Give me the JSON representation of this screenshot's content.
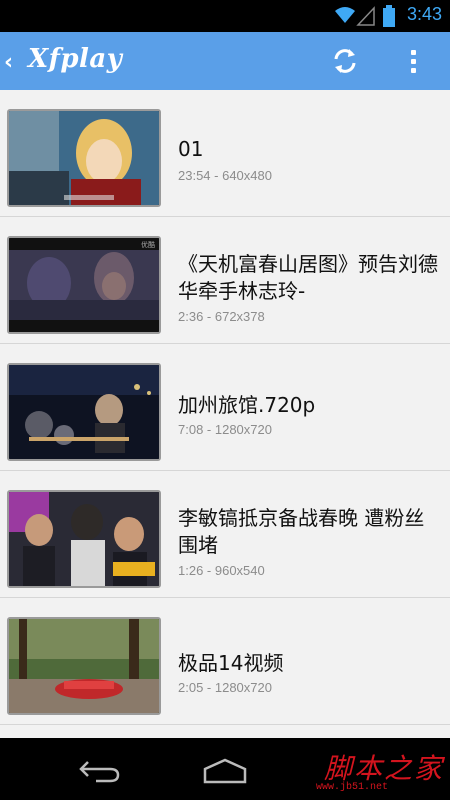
{
  "status_bar": {
    "time": "3:43",
    "icons": [
      "wifi-icon",
      "signal-icon",
      "battery-icon"
    ]
  },
  "action_bar": {
    "title": "Xfplay",
    "back_icon": "chevron-left-icon",
    "actions": [
      "refresh-icon",
      "overflow-menu-icon"
    ],
    "color": "#5a9fe8"
  },
  "videos": [
    {
      "title": "01",
      "meta": "23:54 - 640x480"
    },
    {
      "title": "《天机富春山居图》预告刘德华牵手林志玲-",
      "meta": "2:36 - 672x378"
    },
    {
      "title": "加州旅馆.720p",
      "meta": "7:08 - 1280x720"
    },
    {
      "title": "李敏镐抵京备战春晚 遭粉丝围堵",
      "meta": "1:26 - 960x540"
    },
    {
      "title": "极品14视频",
      "meta": "2:05 - 1280x720"
    }
  ],
  "nav_bar": {
    "icons": [
      "back-icon",
      "home-icon"
    ]
  },
  "watermark": {
    "text": "脚本之家",
    "url": "www.jb51.net"
  }
}
